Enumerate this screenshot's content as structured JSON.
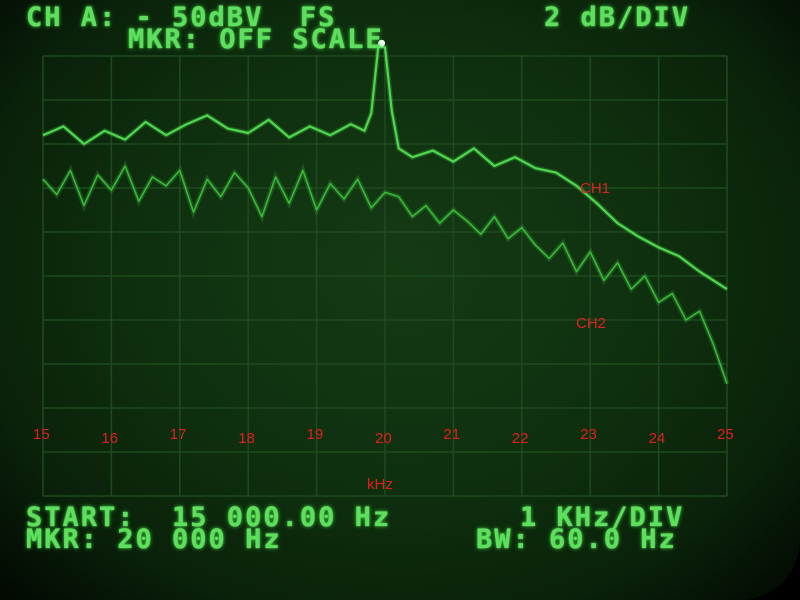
{
  "header": {
    "line1_left": "CH A: - 50dBV  FS",
    "line1_right": "2 dB/DIV",
    "line2": "MKR: OFF SCALE"
  },
  "footer": {
    "start": "START:  15 000.00 Hz",
    "span": "1 KHz/DIV",
    "marker": "MKR: 20 000 Hz",
    "bw": "BW: 60.0 Hz"
  },
  "colors": {
    "phosphor": "#5ee05e",
    "trace_ch1": "#4ed84e",
    "trace_ch2": "#3ab83a",
    "grid": "#1f4a1f",
    "annotation": "#e02020"
  },
  "chart_data": {
    "type": "line",
    "xlabel": "kHz",
    "ylabel": "",
    "categories": [
      15,
      16,
      17,
      18,
      19,
      20,
      21,
      22,
      23,
      24,
      25
    ],
    "xlim": [
      15,
      25
    ],
    "ylim": [
      -20,
      0
    ],
    "grid": true,
    "series": [
      {
        "name": "CH1",
        "x": [
          15.0,
          15.3,
          15.6,
          15.9,
          16.2,
          16.5,
          16.8,
          17.1,
          17.4,
          17.7,
          18.0,
          18.3,
          18.6,
          18.9,
          19.2,
          19.5,
          19.7,
          19.8,
          19.9,
          20.0,
          20.1,
          20.2,
          20.4,
          20.7,
          21.0,
          21.3,
          21.6,
          21.9,
          22.2,
          22.5,
          22.8,
          23.1,
          23.4,
          23.7,
          24.0,
          24.3,
          24.6,
          24.9,
          25.0
        ],
        "y": [
          -3.6,
          -3.2,
          -4.0,
          -3.4,
          -3.8,
          -3.0,
          -3.6,
          -3.1,
          -2.7,
          -3.3,
          -3.5,
          -2.9,
          -3.7,
          -3.2,
          -3.6,
          -3.1,
          -3.4,
          -2.6,
          0.4,
          0.4,
          -2.5,
          -4.2,
          -4.6,
          -4.3,
          -4.8,
          -4.2,
          -5.0,
          -4.6,
          -5.1,
          -5.3,
          -5.9,
          -6.7,
          -7.6,
          -8.2,
          -8.7,
          -9.1,
          -9.8,
          -10.4,
          -10.6
        ]
      },
      {
        "name": "CH2",
        "x": [
          15.0,
          15.2,
          15.4,
          15.6,
          15.8,
          16.0,
          16.2,
          16.4,
          16.6,
          16.8,
          17.0,
          17.2,
          17.4,
          17.6,
          17.8,
          18.0,
          18.2,
          18.4,
          18.6,
          18.8,
          19.0,
          19.2,
          19.4,
          19.6,
          19.8,
          20.0,
          20.2,
          20.4,
          20.6,
          20.8,
          21.0,
          21.2,
          21.4,
          21.6,
          21.8,
          22.0,
          22.2,
          22.4,
          22.6,
          22.8,
          23.0,
          23.2,
          23.4,
          23.6,
          23.8,
          24.0,
          24.2,
          24.4,
          24.6,
          24.8,
          25.0
        ],
        "y": [
          -5.6,
          -6.3,
          -5.2,
          -6.8,
          -5.4,
          -6.1,
          -5.0,
          -6.6,
          -5.5,
          -5.9,
          -5.2,
          -7.1,
          -5.6,
          -6.4,
          -5.3,
          -6.0,
          -7.3,
          -5.5,
          -6.7,
          -5.2,
          -7.0,
          -5.8,
          -6.5,
          -5.6,
          -6.9,
          -6.2,
          -6.4,
          -7.3,
          -6.8,
          -7.6,
          -7.0,
          -7.5,
          -8.1,
          -7.3,
          -8.3,
          -7.8,
          -8.6,
          -9.2,
          -8.5,
          -9.8,
          -8.9,
          -10.2,
          -9.4,
          -10.6,
          -10.0,
          -11.2,
          -10.8,
          -12.0,
          -11.6,
          -13.1,
          -14.9
        ]
      }
    ],
    "annotations": [
      "CH1",
      "CH2"
    ]
  }
}
